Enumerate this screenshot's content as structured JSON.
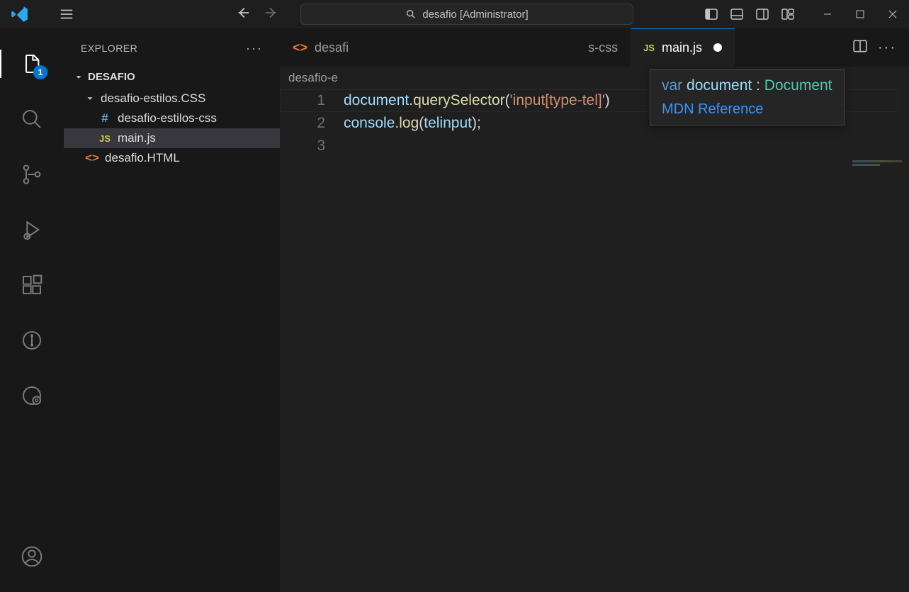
{
  "title_search": "desafio [Administrator]",
  "activity_badge": "1",
  "sidebar": {
    "title": "EXPLORER",
    "folder": "DESAFIO",
    "tree": [
      {
        "name": "desafio-estilos.CSS",
        "kind": "folder-open"
      },
      {
        "name": "desafio-estilos-css",
        "kind": "css"
      },
      {
        "name": "main.js",
        "kind": "js",
        "active": true
      },
      {
        "name": "desafio.HTML",
        "kind": "html"
      }
    ]
  },
  "tabs": [
    {
      "label": "desafi",
      "icon": "html",
      "active": false,
      "partial": true
    },
    {
      "label": "s-css",
      "icon": "css-hidden",
      "active": false,
      "partial_right": true
    },
    {
      "label": "main.js",
      "icon": "js",
      "active": true,
      "dirty": true
    }
  ],
  "breadcrumb": "desafio-e",
  "hover": {
    "sig_kw": "var",
    "sig_name": "document",
    "sig_colon": ":",
    "sig_type": "Document",
    "link": "MDN Reference"
  },
  "code_lines": [
    {
      "n": "1",
      "tokens": [
        {
          "t": "document",
          "c": "tk-obj"
        },
        {
          "t": ".",
          "c": "tk-punc"
        },
        {
          "t": "querySelector",
          "c": "tk-fn"
        },
        {
          "t": "(",
          "c": "tk-punc"
        },
        {
          "t": "'input[type-tel]'",
          "c": "tk-str"
        },
        {
          "t": ")",
          "c": "tk-punc"
        }
      ]
    },
    {
      "n": "2",
      "tokens": [
        {
          "t": "console",
          "c": "tk-obj"
        },
        {
          "t": ".",
          "c": "tk-punc"
        },
        {
          "t": "log",
          "c": "tk-fn"
        },
        {
          "t": "(",
          "c": "tk-punc"
        },
        {
          "t": "telinput",
          "c": "tk-obj"
        },
        {
          "t": ");",
          "c": "tk-punc"
        }
      ]
    },
    {
      "n": "3",
      "tokens": []
    }
  ]
}
